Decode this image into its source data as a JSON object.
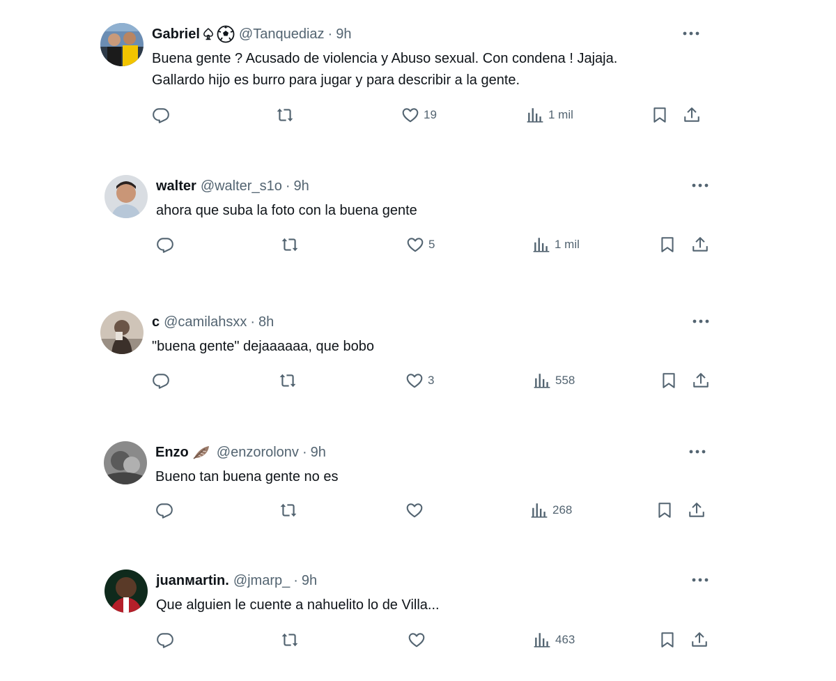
{
  "tweets": [
    {
      "name": "Gabriel",
      "handle": "@Tanquediaz",
      "separator": "·",
      "time": "9h",
      "text": "Buena gente ? Acusado de violencia y Abuso sexual. Con condena ! Jajaja.\nGallardo hijo es burro para jugar y para describir a la gente.",
      "likes": "19",
      "views": "1 mil",
      "name_emojis": [
        "spade-icon",
        "soccer-ball-icon"
      ]
    },
    {
      "name": "walter",
      "handle": "@walter_s1o",
      "separator": "·",
      "time": "9h",
      "text": "ahora que suba la foto con la buena gente",
      "likes": "5",
      "views": "1 mil",
      "name_emojis": []
    },
    {
      "name": "c",
      "handle": "@camilahsxx",
      "separator": "·",
      "time": "8h",
      "text": "\"buena gente\" dejaaaaaa, que bobo",
      "likes": "3",
      "views": "558",
      "name_emojis": []
    },
    {
      "name": "Enzo",
      "handle": "@enzorolonv",
      "separator": "·",
      "time": "9h",
      "text": "Bueno tan buena gente no es",
      "likes": "",
      "views": "268",
      "name_emojis": [
        "feather-icon"
      ]
    },
    {
      "name": "juanмartin.",
      "handle": "@jmarp_",
      "separator": "·",
      "time": "9h",
      "text": "Que alguien le cuente a nahuelito lo de Villa...",
      "likes": "",
      "views": "463",
      "name_emojis": []
    }
  ],
  "colors": {
    "text_primary": "#0f1419",
    "text_secondary": "#536471",
    "background": "#ffffff"
  }
}
